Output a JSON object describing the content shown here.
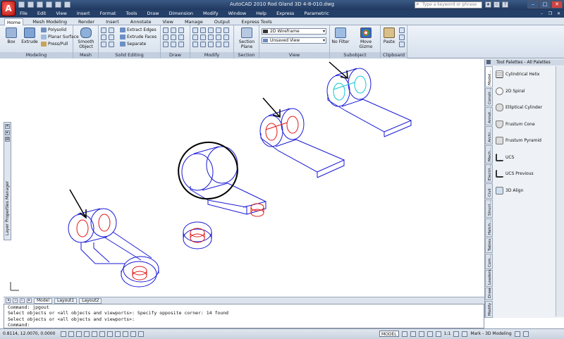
{
  "window": {
    "title": "AutoCAD 2010    Rod Gland 3D 4-8-010.dwg",
    "search_placeholder": "Type a keyword or phrase",
    "logo_letter": "A"
  },
  "menu": [
    "File",
    "Edit",
    "View",
    "Insert",
    "Format",
    "Tools",
    "Draw",
    "Dimension",
    "Modify",
    "Window",
    "Help",
    "Express",
    "Parametric"
  ],
  "ribbon_tabs": [
    "Home",
    "Mesh Modeling",
    "Render",
    "Insert",
    "Annotate",
    "View",
    "Manage",
    "Output",
    "Express Tools"
  ],
  "ribbon": {
    "modeling": {
      "title": "Modeling",
      "box": "Box",
      "extrude": "Extrude",
      "polysolid": "Polysolid",
      "planar_surface": "Planar Surface",
      "presspull": "Press/Pull"
    },
    "mesh": {
      "title": "Mesh",
      "smooth_object": "Smooth Object"
    },
    "solid_editing": {
      "title": "Solid Editing",
      "extract_edges": "Extract Edges",
      "extrude_faces": "Extrude Faces",
      "separate": "Separate"
    },
    "draw": {
      "title": "Draw"
    },
    "modify": {
      "title": "Modify"
    },
    "section": {
      "title": "Section",
      "section_plane": "Section Plane"
    },
    "view": {
      "title": "View",
      "visual_style": "2D Wireframe",
      "saved_view": "Unsaved View"
    },
    "subobject": {
      "title": "Subobject",
      "no_filter": "No Filter",
      "move_gizmo": "Move Gizmo"
    },
    "clipboard": {
      "title": "Clipboard",
      "paste": "Paste"
    }
  },
  "side_panel": {
    "label": "Layer Properties Manager"
  },
  "tool_palette": {
    "title": "Tool Palettes - All Palettes",
    "items": [
      "Cylindrical Helix",
      "2D Spiral",
      "Elliptical Cylinder",
      "Frustum Cone",
      "Frustum Pyramid",
      "UCS",
      "UCS Previous",
      "3D Align"
    ],
    "tabs": [
      "Model...",
      "Constr...",
      "Annot...",
      "Archi...",
      "Mech...",
      "Electri...",
      "Civil",
      "Struct...",
      "Hatch...",
      "Tables",
      "Com...",
      "Leaders",
      "Draw",
      "Modify"
    ]
  },
  "layout_tabs": [
    "Model",
    "Layout1",
    "Layout2"
  ],
  "command_lines": [
    "Command: jpgout",
    "Select objects or <all objects and viewports>: Specify opposite corner: 14 found",
    "Select objects or <all objects and viewports>:",
    "Command:"
  ],
  "status": {
    "coords": "0.8114, 12.0070, 0.0000",
    "model": "MODEL",
    "scale": "1:1",
    "workspace": "Mark - 3D Modeling"
  },
  "colors": {
    "drawing_blue": "#1a1ad6",
    "drawing_red": "#e01818",
    "drawing_cyan": "#10c8d0",
    "markup_black": "#000000"
  }
}
